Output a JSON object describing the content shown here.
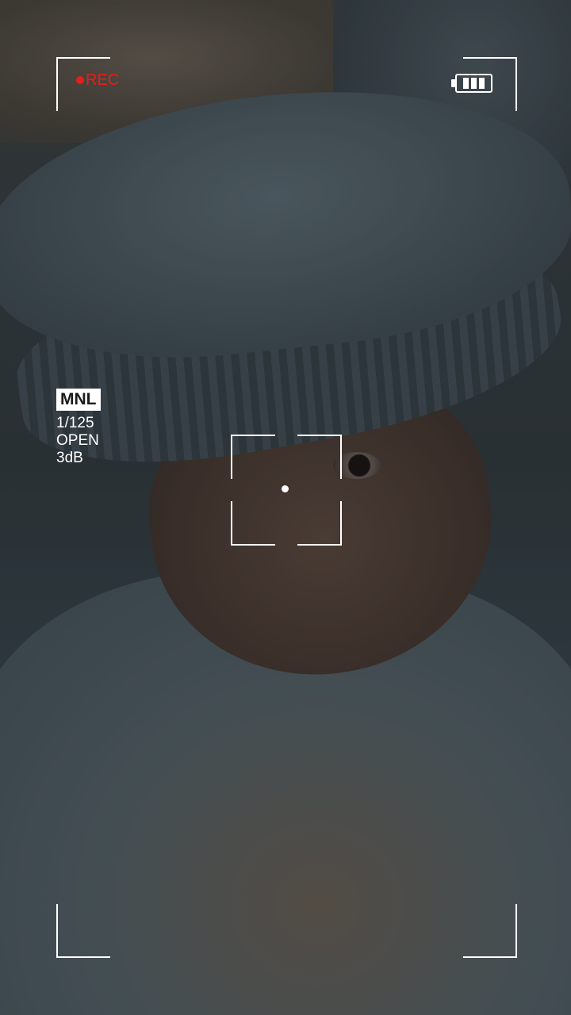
{
  "recording": {
    "label": "REC",
    "color": "#e0201b"
  },
  "battery": {
    "icon": "battery-icon",
    "level_bars": 3
  },
  "exposure": {
    "mode": "MNL",
    "shutter_speed": "1/125",
    "aperture": "OPEN",
    "gain": "3dB"
  },
  "focus": {
    "icon": "focus-point-icon"
  }
}
